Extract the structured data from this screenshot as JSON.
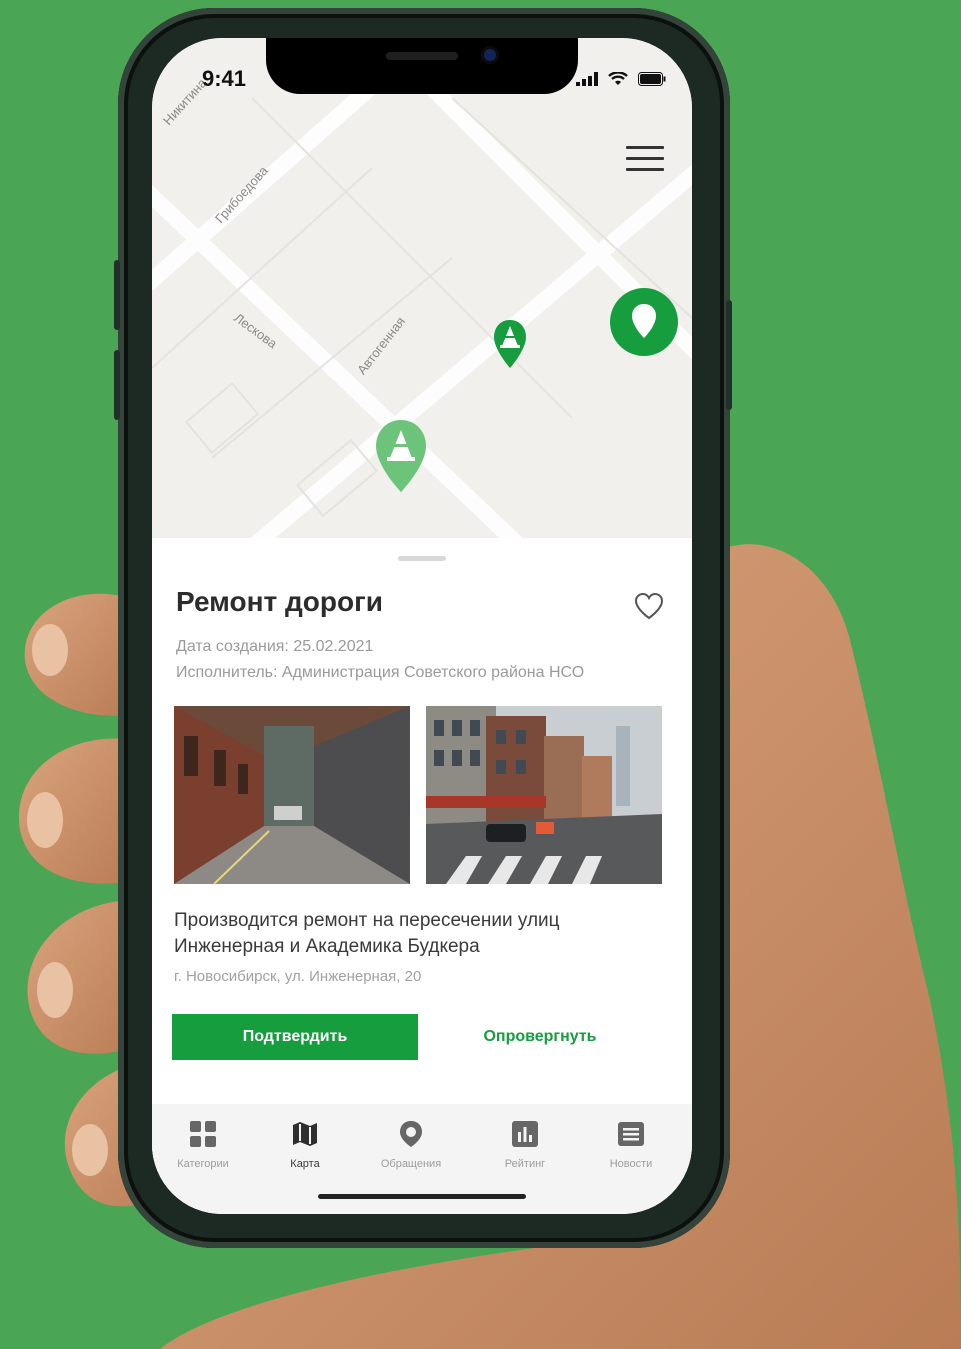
{
  "status_bar": {
    "time": "9:41"
  },
  "map": {
    "streets": [
      "Никитина",
      "Грибоедова",
      "Лескова",
      "Автогенная"
    ]
  },
  "issue": {
    "title": "Ремонт дороги",
    "created": "Дата создания: 25.02.2021",
    "executor": "Исполнитель: Администрация Советского района НСО",
    "description": "Производится ремонт на пересечении улиц Инженерная и Академика Будкера",
    "address": "г. Новосибирск, ул. Инженерная, 20"
  },
  "actions": {
    "confirm": "Подтвердить",
    "deny": "Опровергнуть"
  },
  "tabs": [
    {
      "label": "Категории",
      "icon": "grid-icon"
    },
    {
      "label": "Карта",
      "icon": "map-icon"
    },
    {
      "label": "Обращения",
      "icon": "pin-icon"
    },
    {
      "label": "Рейтинг",
      "icon": "chart-icon"
    },
    {
      "label": "Новости",
      "icon": "news-icon"
    }
  ],
  "active_tab": "Карта",
  "colors": {
    "brand_green": "#169d3e",
    "background_green": "#4aa555"
  }
}
